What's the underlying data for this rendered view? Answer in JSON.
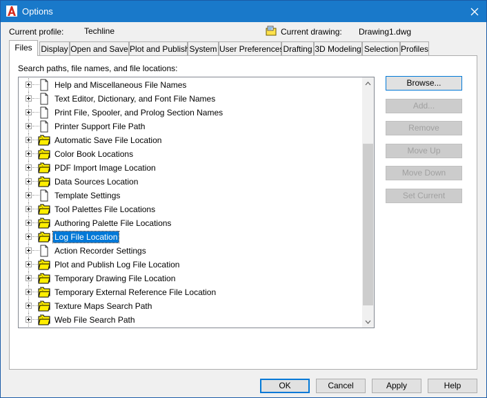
{
  "window": {
    "title": "Options",
    "close_label": "close",
    "accent": "#1979ca"
  },
  "header": {
    "profile_label": "Current profile:",
    "profile_value": "Techline",
    "drawing_label": "Current drawing:",
    "drawing_value": "Drawing1.dwg"
  },
  "tabs": [
    {
      "label": "Files",
      "active": true
    },
    {
      "label": "Display"
    },
    {
      "label": "Open and Save"
    },
    {
      "label": "Plot and Publish"
    },
    {
      "label": "System"
    },
    {
      "label": "User Preferences"
    },
    {
      "label": "Drafting"
    },
    {
      "label": "3D Modeling"
    },
    {
      "label": "Selection"
    },
    {
      "label": "Profiles"
    }
  ],
  "files": {
    "section_label": "Search paths, file names, and file locations:",
    "tree_items": [
      {
        "label": "Help and Miscellaneous File Names",
        "icon": "document-icon"
      },
      {
        "label": "Text Editor, Dictionary, and Font File Names",
        "icon": "document-icon"
      },
      {
        "label": "Print File, Spooler, and Prolog Section Names",
        "icon": "document-icon"
      },
      {
        "label": "Printer Support File Path",
        "icon": "document-icon"
      },
      {
        "label": "Automatic Save File Location",
        "icon": "folder-icon"
      },
      {
        "label": "Color Book Locations",
        "icon": "folder-icon"
      },
      {
        "label": "PDF Import Image Location",
        "icon": "folder-icon"
      },
      {
        "label": "Data Sources Location",
        "icon": "folder-icon"
      },
      {
        "label": "Template Settings",
        "icon": "document-icon"
      },
      {
        "label": "Tool Palettes File Locations",
        "icon": "folder-icon"
      },
      {
        "label": "Authoring Palette File Locations",
        "icon": "folder-icon"
      },
      {
        "label": "Log File Location",
        "icon": "folder-icon",
        "selected": true
      },
      {
        "label": "Action Recorder Settings",
        "icon": "document-icon"
      },
      {
        "label": "Plot and Publish Log File Location",
        "icon": "folder-icon"
      },
      {
        "label": "Temporary Drawing File Location",
        "icon": "folder-icon"
      },
      {
        "label": "Temporary External Reference File Location",
        "icon": "folder-icon"
      },
      {
        "label": "Texture Maps Search Path",
        "icon": "folder-icon"
      },
      {
        "label": "Web File Search Path",
        "icon": "folder-icon"
      }
    ],
    "buttons": {
      "browse": "Browse...",
      "add": "Add...",
      "remove": "Remove",
      "move_up": "Move Up",
      "move_down": "Move Down",
      "set_current": "Set Current"
    }
  },
  "footer": {
    "ok": "OK",
    "cancel": "Cancel",
    "apply": "Apply",
    "help": "Help"
  },
  "colors": {
    "selection": "#0078d7",
    "folder_fill": "#ffee00"
  }
}
